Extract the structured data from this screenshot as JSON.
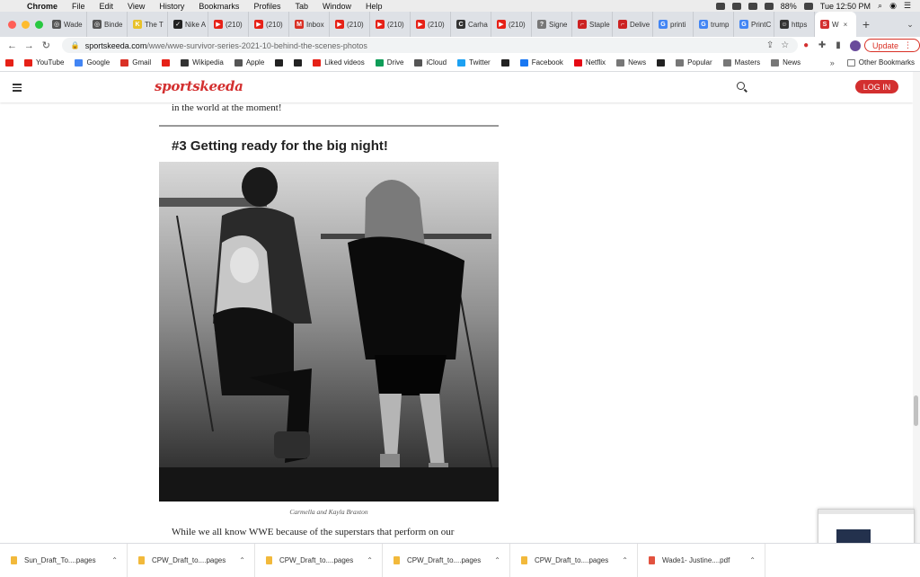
{
  "menubar": {
    "app": "Chrome",
    "items": [
      "File",
      "Edit",
      "View",
      "History",
      "Bookmarks",
      "Profiles",
      "Tab",
      "Window",
      "Help"
    ],
    "battery": "88%",
    "clock": "Tue 12:50 PM"
  },
  "tabs": [
    {
      "label": "Wade",
      "color": "#555555",
      "glyph": "◎"
    },
    {
      "label": "Binde",
      "color": "#555555",
      "glyph": "◎"
    },
    {
      "label": "The T",
      "color": "#e8c22a",
      "glyph": "K"
    },
    {
      "label": "Nike A",
      "color": "#222222",
      "glyph": "✓"
    },
    {
      "label": "(210)",
      "color": "#e62117",
      "glyph": "▶"
    },
    {
      "label": "(210)",
      "color": "#e62117",
      "glyph": "▶"
    },
    {
      "label": "Inbox",
      "color": "#d93025",
      "glyph": "M"
    },
    {
      "label": "(210)",
      "color": "#e62117",
      "glyph": "▶"
    },
    {
      "label": "(210)",
      "color": "#e62117",
      "glyph": "▶"
    },
    {
      "label": "(210)",
      "color": "#e62117",
      "glyph": "▶"
    },
    {
      "label": "Carha",
      "color": "#333333",
      "glyph": "C"
    },
    {
      "label": "(210)",
      "color": "#e62117",
      "glyph": "▶"
    },
    {
      "label": "Signe",
      "color": "#777777",
      "glyph": "?"
    },
    {
      "label": "Staple",
      "color": "#cc2222",
      "glyph": "⌐"
    },
    {
      "label": "Delive",
      "color": "#cc2222",
      "glyph": "⌐"
    },
    {
      "label": "printi",
      "color": "#4285f4",
      "glyph": "G"
    },
    {
      "label": "trump",
      "color": "#4285f4",
      "glyph": "G"
    },
    {
      "label": "PrintC",
      "color": "#4285f4",
      "glyph": "G"
    },
    {
      "label": "https",
      "color": "#333333",
      "glyph": "☺"
    },
    {
      "label": "W",
      "color": "#d32f2f",
      "glyph": "S",
      "active": true
    }
  ],
  "toolbar": {
    "url_host": "sportskeeda.com",
    "url_path": "/wwe/wwe-survivor-series-2021-10-behind-the-scenes-photos",
    "update_label": "Update"
  },
  "bookmarks": [
    {
      "label": "",
      "color": "#e62117"
    },
    {
      "label": "YouTube",
      "color": "#e62117"
    },
    {
      "label": "Google",
      "color": "#4285f4"
    },
    {
      "label": "Gmail",
      "color": "#d93025"
    },
    {
      "label": "",
      "color": "#e62117"
    },
    {
      "label": "Wikipedia",
      "color": "#333333"
    },
    {
      "label": "Apple",
      "color": "#555555"
    },
    {
      "label": "",
      "color": "#222222"
    },
    {
      "label": "",
      "color": "#222222"
    },
    {
      "label": "Liked videos",
      "color": "#e62117"
    },
    {
      "label": "Drive",
      "color": "#0f9d58"
    },
    {
      "label": "iCloud",
      "color": "#555555"
    },
    {
      "label": "Twitter",
      "color": "#1da1f2"
    },
    {
      "label": "",
      "color": "#222222"
    },
    {
      "label": "Facebook",
      "color": "#1877f2"
    },
    {
      "label": "Netflix",
      "color": "#e50914"
    },
    {
      "label": "News",
      "color": "#777777"
    },
    {
      "label": "",
      "color": "#222222"
    },
    {
      "label": "Popular",
      "color": "#777777"
    },
    {
      "label": "Masters",
      "color": "#777777"
    },
    {
      "label": "News",
      "color": "#777777"
    }
  ],
  "bookmarks_more": "»",
  "other_bookmarks": "Other Bookmarks",
  "site": {
    "logo": "sportskeeda",
    "login_label": "LOG IN",
    "accent": "#d32f2f"
  },
  "article": {
    "para_top": "in the world at the moment!",
    "section_title": "#3 Getting ready for the big night!",
    "caption": "Carmella and Kayla Braxton",
    "para_bottom": "While we all know WWE because of the superstars that perform on our"
  },
  "downloads": [
    {
      "label": "Sun_Draft_To....pages",
      "type": "pages"
    },
    {
      "label": "CPW_Draft_to....pages",
      "type": "pages"
    },
    {
      "label": "CPW_Draft_to....pages",
      "type": "pages"
    },
    {
      "label": "CPW_Draft_to....pages",
      "type": "pages"
    },
    {
      "label": "CPW_Draft_to....pages",
      "type": "pages"
    },
    {
      "label": "Wade1- Justine....pdf",
      "type": "pdf"
    }
  ]
}
